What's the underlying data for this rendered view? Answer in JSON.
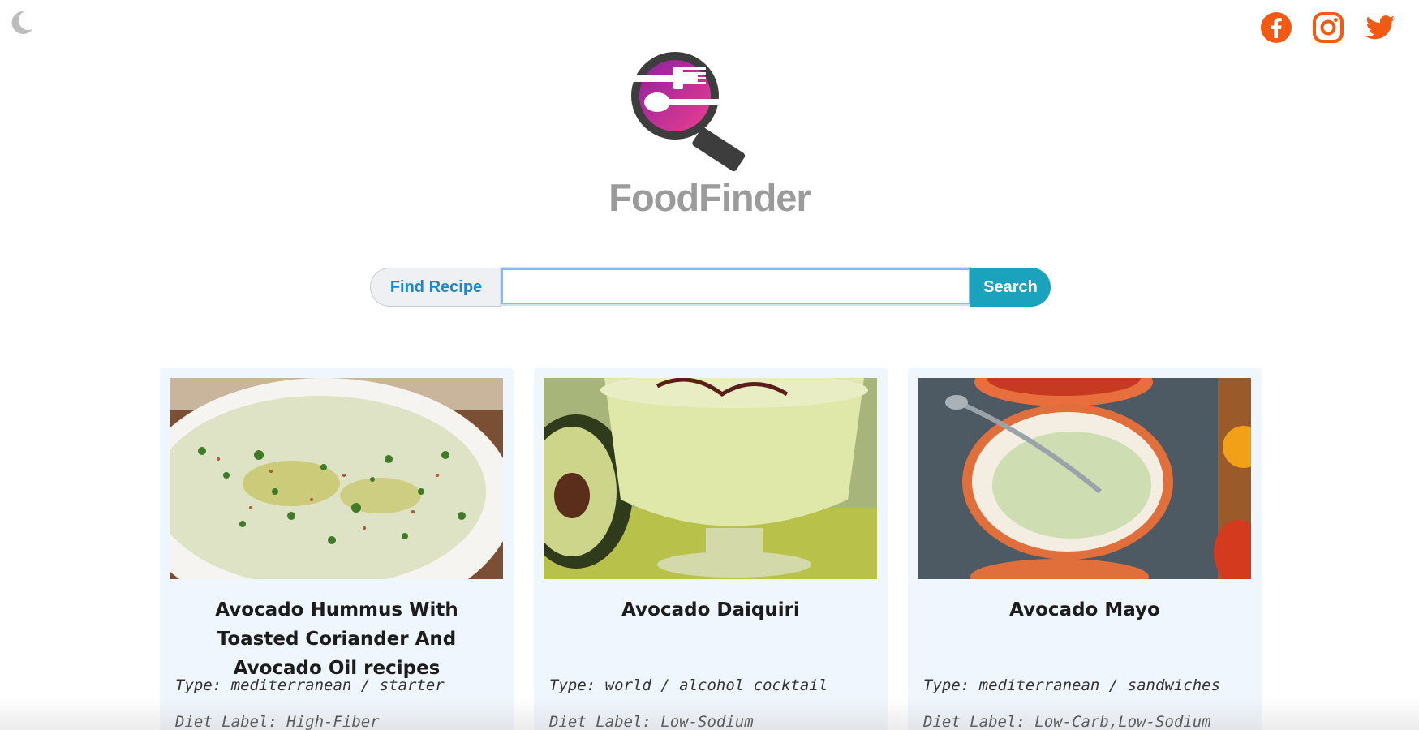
{
  "header": {
    "theme_toggle_icon": "moon-icon",
    "social": [
      {
        "name": "facebook-icon",
        "color": "#f25a14"
      },
      {
        "name": "instagram-icon",
        "color": "#f25a14"
      },
      {
        "name": "twitter-icon",
        "color": "#f25a14"
      }
    ]
  },
  "logo": {
    "text": "FoodFinder",
    "icon": "magnifier-fork-spoon-logo",
    "colors": [
      "#a21c8e",
      "#e83e8c",
      "#3d3d3d"
    ]
  },
  "search": {
    "label": "Find Recipe",
    "value": "",
    "placeholder": "",
    "button_label": "Search",
    "button_color": "#1ba2bd"
  },
  "recipes": [
    {
      "title": "Avocado Hummus With Toasted Coriander And Avocado Oil recipes",
      "type": "Type: mediterranean / starter",
      "diet": "Diet Label: High-Fiber"
    },
    {
      "title": "Avocado Daiquiri",
      "type": "Type: world / alcohol cocktail",
      "diet": "Diet Label: Low-Sodium"
    },
    {
      "title": "Avocado Mayo",
      "type": "Type: mediterranean / sandwiches",
      "diet": "Diet Label: Low-Carb,Low-Sodium"
    }
  ]
}
